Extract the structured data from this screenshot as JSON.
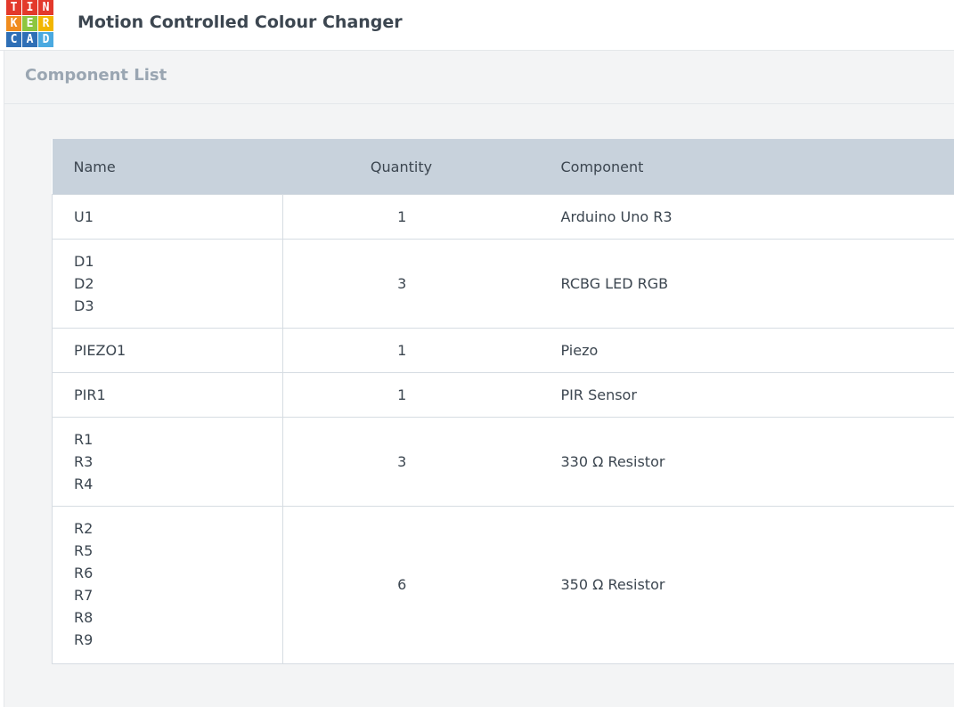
{
  "app": {
    "logo_letters": [
      "T",
      "I",
      "N",
      "K",
      "E",
      "R",
      "C",
      "A",
      "D"
    ],
    "logo_colors": [
      "#e3392b",
      "#e3392b",
      "#e3392b",
      "#f08c1e",
      "#f08c1e",
      "#f08c1e",
      "#2f6fb6",
      "#2f6fb6",
      "#2f6fb6"
    ],
    "project_title": "Motion Controlled Colour Changer"
  },
  "panel": {
    "title": "Component List"
  },
  "table": {
    "headers": {
      "name": "Name",
      "quantity": "Quantity",
      "component": "Component"
    },
    "rows": [
      {
        "names": [
          "U1"
        ],
        "quantity": "1",
        "component": "Arduino Uno R3"
      },
      {
        "names": [
          "D1",
          "D2",
          "D3"
        ],
        "quantity": "3",
        "component": "RCBG LED RGB"
      },
      {
        "names": [
          "PIEZO1"
        ],
        "quantity": "1",
        "component": "Piezo"
      },
      {
        "names": [
          "PIR1"
        ],
        "quantity": "1",
        "component": "PIR Sensor"
      },
      {
        "names": [
          "R1",
          "R3",
          "R4"
        ],
        "quantity": "3",
        "component": "330 Ω Resistor"
      },
      {
        "names": [
          "R2",
          "R5",
          "R6",
          "R7",
          "R8",
          "R9"
        ],
        "quantity": "6",
        "component": "350 Ω Resistor"
      }
    ]
  }
}
